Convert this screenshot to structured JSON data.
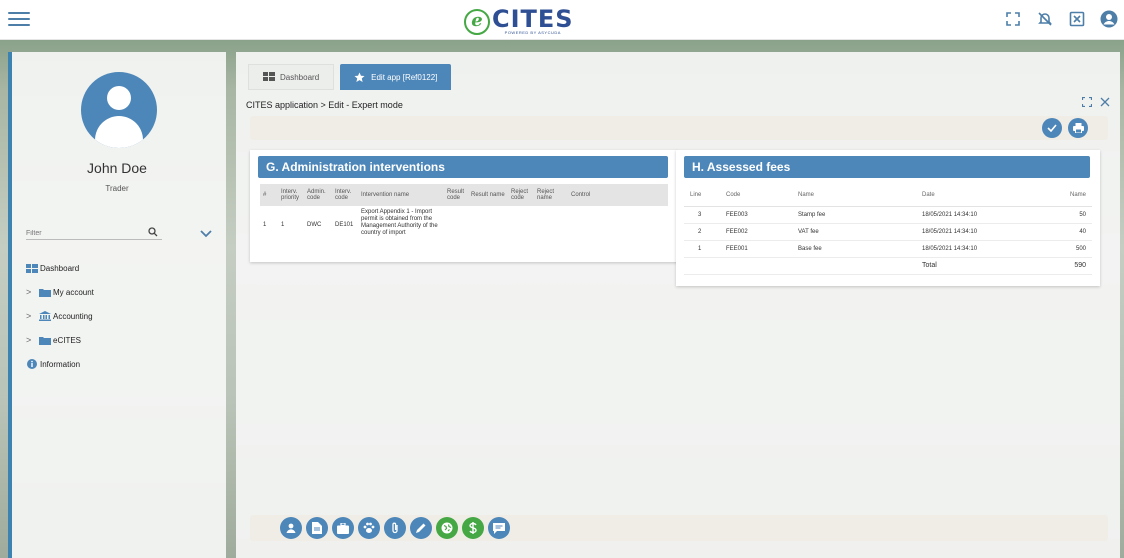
{
  "colors": {
    "primary": "#4d86b8",
    "green": "#45a845",
    "brand_blue": "#2e4f93"
  },
  "brand": {
    "logo_letter": "e",
    "name": "CITES",
    "subtitle": "POWERED BY ASYCUDA"
  },
  "top_icons": [
    "fullscreen-icon",
    "notifications-off-icon",
    "close-window-icon",
    "user-icon"
  ],
  "sidebar": {
    "user_name": "John Doe",
    "user_role": "Trader",
    "filter_placeholder": "Filter",
    "items": [
      {
        "label": "Dashboard",
        "icon": "dashboard-icon",
        "has_chevron": false
      },
      {
        "label": "My account",
        "icon": "folder-icon",
        "has_chevron": true
      },
      {
        "label": "Accounting",
        "icon": "bank-icon",
        "has_chevron": true
      },
      {
        "label": "eCITES",
        "icon": "folder-icon",
        "has_chevron": true
      },
      {
        "label": "Information",
        "icon": "info-icon",
        "has_chevron": false
      }
    ]
  },
  "tabs": [
    {
      "label": "Dashboard",
      "icon": "dashboard-icon",
      "active": false
    },
    {
      "label": "Edit app [Ref0122]",
      "icon": "star-icon",
      "active": true
    }
  ],
  "breadcrumb": "CITES application > Edit - Expert mode",
  "admin": {
    "title": "G. Administration interventions",
    "headers": [
      "#",
      "Interv. priority",
      "Admin. code",
      "Interv. code",
      "Intervention name",
      "Result code",
      "Result name",
      "Reject code",
      "Reject name",
      "Control"
    ],
    "rows": [
      [
        "1",
        "1",
        "DWC",
        "DE101",
        "Export Appendix 1 - Import permit is obtained from the Management Authority of the country of import",
        "",
        "",
        "",
        "",
        ""
      ]
    ]
  },
  "fees": {
    "title": "H. Assessed fees",
    "headers": [
      "Line",
      "Code",
      "Name",
      "Date",
      "Name"
    ],
    "rows": [
      [
        "3",
        "FEE003",
        "Stamp fee",
        "18/05/2021 14:34:10",
        "50"
      ],
      [
        "2",
        "FEE002",
        "VAT fee",
        "18/05/2021 14:34:10",
        "40"
      ],
      [
        "1",
        "FEE001",
        "Base fee",
        "18/05/2021 14:34:10",
        "500"
      ]
    ],
    "total_label": "Total",
    "total_value": "590"
  },
  "actions": [
    {
      "name": "user-icon",
      "color": "#4d86b8"
    },
    {
      "name": "document-icon",
      "color": "#4d86b8"
    },
    {
      "name": "briefcase-icon",
      "color": "#4d86b8"
    },
    {
      "name": "paw-icon",
      "color": "#4d86b8"
    },
    {
      "name": "attachment-icon",
      "color": "#4d86b8"
    },
    {
      "name": "pencil-icon",
      "color": "#4d86b8"
    },
    {
      "name": "globe-icon",
      "color": "#45a845"
    },
    {
      "name": "dollar-icon",
      "color": "#45a845"
    },
    {
      "name": "message-icon",
      "color": "#4d86b8"
    }
  ]
}
